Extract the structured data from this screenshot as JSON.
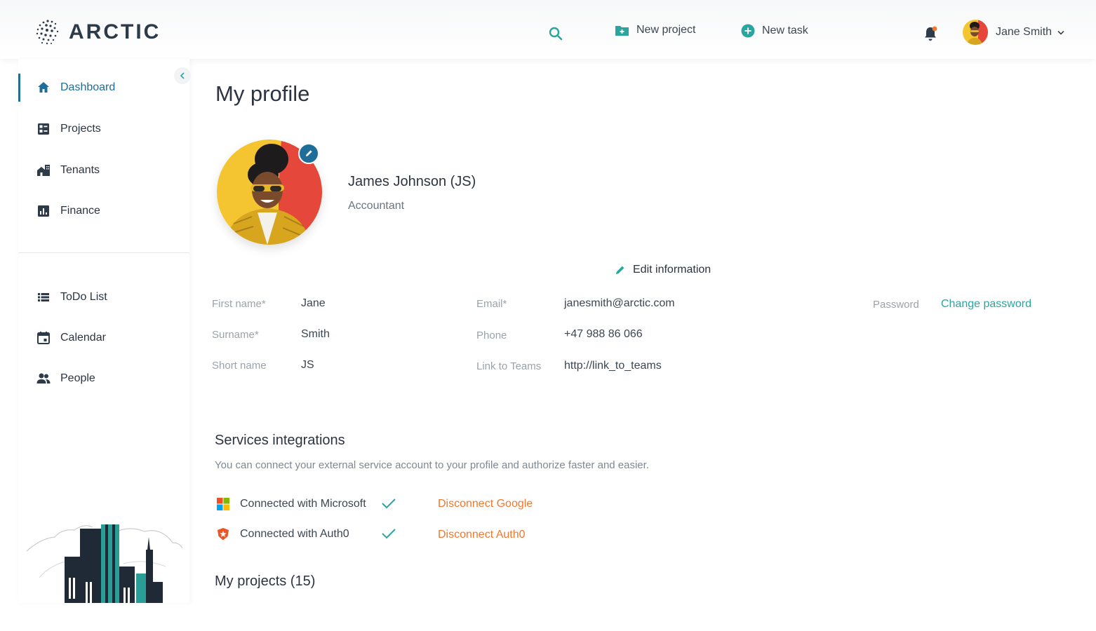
{
  "header": {
    "brand": "ARCTIC",
    "new_project_label": "New project",
    "new_task_label": "New task",
    "user_name": "Jane Smith"
  },
  "sidebar": {
    "main_items": [
      {
        "label": "Dashboard",
        "icon": "home-icon",
        "active": true
      },
      {
        "label": "Projects",
        "icon": "projects-icon"
      },
      {
        "label": "Tenants",
        "icon": "tenants-icon"
      },
      {
        "label": "Finance",
        "icon": "finance-icon"
      }
    ],
    "secondary_items": [
      {
        "label": "ToDo List",
        "icon": "list-icon"
      },
      {
        "label": "Calendar",
        "icon": "calendar-icon"
      },
      {
        "label": "People",
        "icon": "people-icon"
      }
    ]
  },
  "page": {
    "title": "My profile",
    "profile_name": "James Johnson (JS)",
    "profile_role": "Accountant",
    "edit_info_label": "Edit information"
  },
  "fields": {
    "first_name_label": "First name*",
    "first_name_value": "Jane",
    "surname_label": "Surname*",
    "surname_value": "Smith",
    "short_name_label": "Short name",
    "short_name_value": "JS",
    "email_label": "Email*",
    "email_value": "janesmith@arctic.com",
    "phone_label": "Phone",
    "phone_value": "+47 988 86 066",
    "teams_label": "Link to Teams",
    "teams_value": "http://link_to_teams",
    "password_label": "Password",
    "change_password_label": "Change password"
  },
  "services": {
    "title": "Services integrations",
    "description": "You can connect your external service account to your profile and authorize faster and easier.",
    "items": [
      {
        "label": "Connected with Microsoft",
        "action": "Disconnect Google",
        "icon": "microsoft-icon"
      },
      {
        "label": "Connected with Auth0",
        "action": "Disconnect Auth0",
        "icon": "auth0-icon"
      }
    ]
  },
  "projects": {
    "title": "My projects (15)"
  },
  "colors": {
    "primary": "#1f6e99",
    "teal": "#2aa5a0",
    "orange": "#f0782f",
    "text": "#2b3440",
    "muted": "#9aa3ab"
  }
}
